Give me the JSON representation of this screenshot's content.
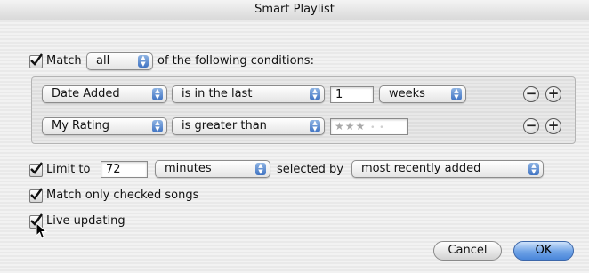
{
  "window": {
    "title": "Smart Playlist"
  },
  "match": {
    "checked": true,
    "label": "Match",
    "mode_value": "all",
    "suffix": "of the following conditions:"
  },
  "conditions": [
    {
      "field": "Date Added",
      "operator": "is in the last",
      "value": "1",
      "unit": "weeks"
    },
    {
      "field": "My Rating",
      "operator": "is greater than",
      "rating_filled": "★★★",
      "rating_empty": "• •",
      "rating_value": 3
    }
  ],
  "limit": {
    "checked": true,
    "label": "Limit to",
    "value": "72",
    "unit": "minutes",
    "selected_by_label": "selected by",
    "selected_by_value": "most recently added"
  },
  "match_only_checked": {
    "checked": true,
    "label": "Match only checked songs"
  },
  "live_updating": {
    "checked": true,
    "label": "Live updating"
  },
  "buttons": {
    "cancel": "Cancel",
    "ok": "OK"
  },
  "colors": {
    "accent": "#5b90dd",
    "stripe_light": "#f2f2f2",
    "stripe_dark": "#e9e9e9"
  }
}
